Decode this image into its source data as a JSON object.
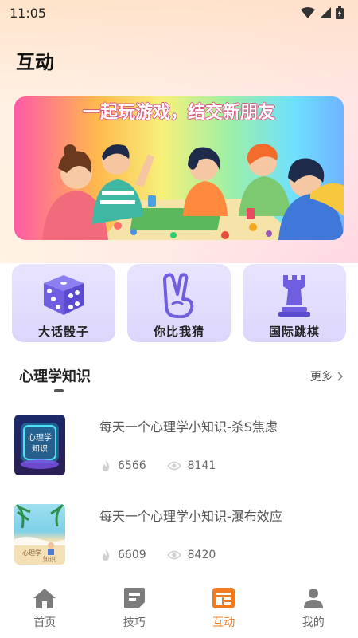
{
  "status_bar": {
    "time": "11:05"
  },
  "page": {
    "title": "互动"
  },
  "banner": {
    "title": "一起玩游戏，结交新朋友"
  },
  "features": [
    {
      "label": "大话骰子",
      "icon": "dice-icon"
    },
    {
      "label": "你比我猜",
      "icon": "victory-hand-icon"
    },
    {
      "label": "国际跳棋",
      "icon": "chess-rook-icon"
    }
  ],
  "section": {
    "title": "心理学知识",
    "more_label": "更多"
  },
  "articles": [
    {
      "title": "每天一个心理学小知识-杀S焦虑",
      "likes": "6566",
      "views": "8141",
      "thumb_text": "心理学知识"
    },
    {
      "title": "每天一个心理学小知识-瀑布效应",
      "likes": "6609",
      "views": "8420",
      "thumb_text": "心理学知识"
    }
  ],
  "tabs": [
    {
      "label": "首页",
      "icon": "home-icon"
    },
    {
      "label": "技巧",
      "icon": "tips-icon"
    },
    {
      "label": "互动",
      "icon": "interaction-icon",
      "active": true
    },
    {
      "label": "我的",
      "icon": "profile-icon"
    }
  ],
  "colors": {
    "accent": "#f07a1f",
    "card_bg": "#e3defd",
    "icon_purple": "#6f5fe0"
  }
}
